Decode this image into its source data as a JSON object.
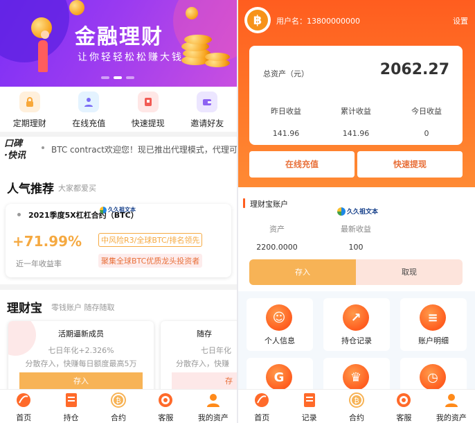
{
  "left": {
    "banner": {
      "title": "金融理财",
      "subtitle": "让你轻轻松松赚大钱"
    },
    "quick_actions": [
      {
        "label": "定期理财",
        "icon": "lock-icon",
        "color": "#f8a83a",
        "bg": "#fff0dc"
      },
      {
        "label": "在线充值",
        "icon": "user-icon",
        "color": "#7b6cf6",
        "bg": "#e4f3ff"
      },
      {
        "label": "快速提现",
        "icon": "withdraw-icon",
        "color": "#f25b54",
        "bg": "#ffe7e6"
      },
      {
        "label": "邀请好友",
        "icon": "wallet-icon",
        "color": "#8d63f2",
        "bg": "#ece6ff"
      }
    ],
    "news": {
      "logo_line1": "口碑",
      "logo_line2": "·快讯",
      "text": "BTC contract欢迎您！现已推出代理模式，代理可"
    },
    "popular": {
      "title": "人气推荐",
      "subtitle": "大家都爱买"
    },
    "product": {
      "name": "2021季度5X杠杠合约（BTC）",
      "rate": "+71.99%",
      "rate_label": "近一年收益率",
      "tag1": "中风险R3/全球BTC/排名领先",
      "tag2": "聚集全球BTC优质龙头投资者",
      "watermark": "久久祖文本"
    },
    "treasure": {
      "title": "理财宝",
      "subtitle": "零钱账户 随存随取"
    },
    "cards": [
      {
        "title": "活期逼新成员",
        "rate": "七日年化+2.326%",
        "desc": "分散存入，快赚每日额度最高5万",
        "button": "存入"
      },
      {
        "title": "随存",
        "rate": "七日年化",
        "desc": "分散存入，快赚",
        "button": "存"
      }
    ],
    "tabs": [
      {
        "label": "首页",
        "icon": "home-icon"
      },
      {
        "label": "持仓",
        "icon": "document-icon"
      },
      {
        "label": "合约",
        "icon": "bitcoin-icon"
      },
      {
        "label": "客服",
        "icon": "support-icon"
      },
      {
        "label": "我的资产",
        "icon": "person-icon"
      }
    ]
  },
  "right": {
    "header": {
      "username": "用户名：13800000000",
      "settings": "设置",
      "btc_symbol": "฿"
    },
    "assets": {
      "total_label": "总资产（元）",
      "total_value": "2062.27",
      "stats": [
        {
          "label": "昨日收益",
          "value": "141.96"
        },
        {
          "label": "累计收益",
          "value": "141.96"
        },
        {
          "label": "今日收益",
          "value": "0"
        }
      ]
    },
    "buttons": {
      "recharge": "在线充值",
      "withdraw": "快速提现"
    },
    "account": {
      "title": "理财宝账户",
      "asset_label": "资产",
      "asset_value": "2200.0000",
      "yield_label": "最新收益",
      "yield_value": "100",
      "deposit": "存入",
      "withdraw": "取现",
      "watermark": "久久祖文本"
    },
    "grid": [
      {
        "label": "个人信息",
        "icon": "smile-icon"
      },
      {
        "label": "持仓记录",
        "icon": "chart-icon"
      },
      {
        "label": "账户明细",
        "icon": "list-icon"
      },
      {
        "label": "",
        "icon": "refresh-icon"
      },
      {
        "label": "",
        "icon": "trophy-icon"
      },
      {
        "label": "",
        "icon": "clock-icon"
      }
    ],
    "tabs": [
      {
        "label": "首页",
        "icon": "home-icon"
      },
      {
        "label": "记录",
        "icon": "document-icon"
      },
      {
        "label": "合约",
        "icon": "bitcoin-icon"
      },
      {
        "label": "客服",
        "icon": "support-icon"
      },
      {
        "label": "我的资产",
        "icon": "person-icon"
      }
    ]
  }
}
